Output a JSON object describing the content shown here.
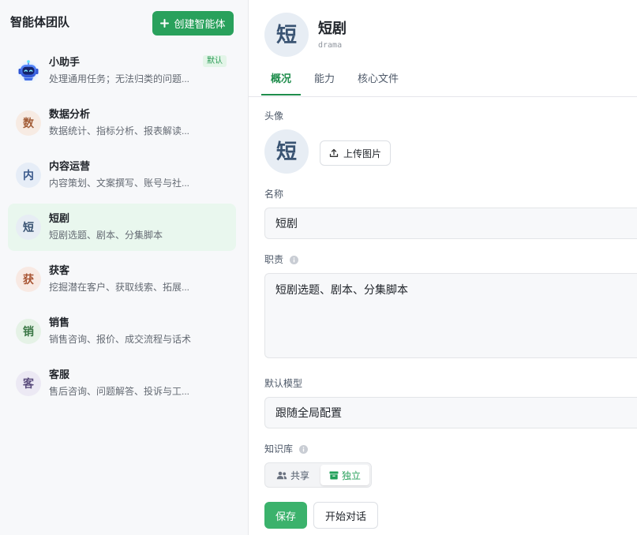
{
  "theme": {
    "primary": "#29a15c",
    "primary_soft": "#3bb26c",
    "selected_bg": "#e9f7ee",
    "badge_bg": "#e3f5e8",
    "badge_text": "#2a9a55",
    "active_tab": "#1f8d4c"
  },
  "sidebar": {
    "title": "智能体团队",
    "create_button": {
      "icon": "plus-icon",
      "label": "创建智能体"
    },
    "agents": [
      {
        "name": "小助手",
        "description": "处理通用任务；无法归类的问题...",
        "avatar_icon": "robot-icon",
        "badge": "默认",
        "selected": false
      },
      {
        "name": "数据分析",
        "description": "数据统计、指标分析、报表解读...",
        "avatar_text": "数",
        "avatar_bg": "#f7ebe3",
        "avatar_color": "#a35e39",
        "selected": false
      },
      {
        "name": "内容运营",
        "description": "内容策划、文案撰写、账号与社...",
        "avatar_text": "内",
        "avatar_bg": "#e6edf7",
        "avatar_color": "#3b5a8c",
        "selected": false
      },
      {
        "name": "短剧",
        "description": "短剧选题、剧本、分集脚本",
        "avatar_text": "短",
        "avatar_bg": "#e7edf4",
        "avatar_color": "#3a5473",
        "selected": true
      },
      {
        "name": "获客",
        "description": "挖掘潜在客户、获取线索、拓展...",
        "avatar_text": "获",
        "avatar_bg": "#f8e9e3",
        "avatar_color": "#a85433",
        "selected": false
      },
      {
        "name": "销售",
        "description": "销售咨询、报价、成交流程与话术",
        "avatar_text": "销",
        "avatar_bg": "#e5f2e6",
        "avatar_color": "#3a7645",
        "selected": false
      },
      {
        "name": "客服",
        "description": "售后咨询、问题解答、投诉与工...",
        "avatar_text": "客",
        "avatar_bg": "#ece9f4",
        "avatar_color": "#5b4d7d",
        "selected": false
      }
    ]
  },
  "header": {
    "avatar_text": "短",
    "avatar_bg": "#e7edf4",
    "avatar_color": "#3a5473",
    "title": "短剧",
    "subtitle": "drama"
  },
  "tabs": [
    {
      "label": "概况",
      "active": true
    },
    {
      "label": "能力",
      "active": false
    },
    {
      "label": "核心文件",
      "active": false
    }
  ],
  "form": {
    "avatar": {
      "label": "头像",
      "text": "短",
      "bg": "#e7edf4",
      "color": "#3a5473",
      "upload_icon": "upload-icon",
      "upload_label": "上传图片"
    },
    "name": {
      "label": "名称",
      "value": "短剧"
    },
    "duty": {
      "label": "职责",
      "info_icon": "info-icon",
      "value": "短剧选题、剧本、分集脚本"
    },
    "default_model": {
      "label": "默认模型",
      "value": "跟随全局配置"
    },
    "knowledge_base": {
      "label": "知识库",
      "info_icon": "info-icon",
      "options": [
        {
          "label": "共享",
          "icon": "users-icon",
          "active": false
        },
        {
          "label": "独立",
          "icon": "archive-icon",
          "active": true
        }
      ]
    },
    "actions": {
      "save_label": "保存",
      "start_chat_label": "开始对话"
    }
  }
}
